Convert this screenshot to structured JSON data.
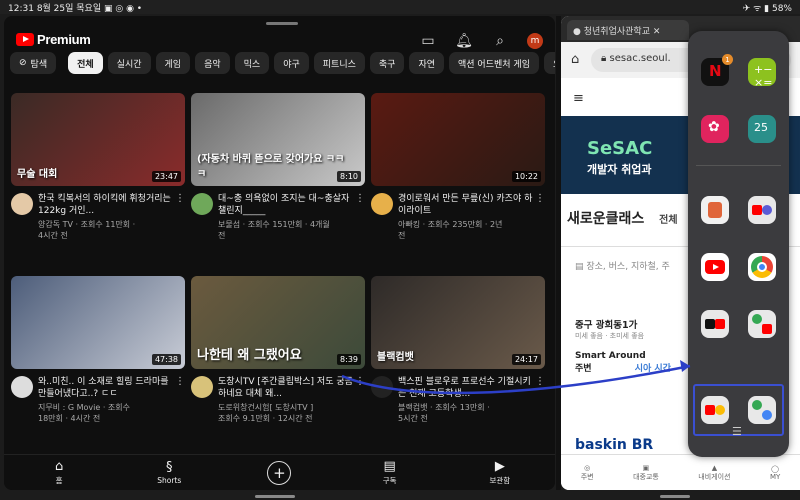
{
  "status": {
    "time": "12:31",
    "date": "8월 25일 목요일",
    "battery": "58%"
  },
  "youtube": {
    "logo": "Premium",
    "avatar_letter": "m",
    "chips": [
      "탐색",
      "전체",
      "실시간",
      "게임",
      "음악",
      "믹스",
      "야구",
      "피트니스",
      "축구",
      "자연",
      "액션 어드벤처 게임",
      "요리"
    ],
    "videos": [
      {
        "title": "한국 킥복서의 하이킥에 휘청거리는 122kg 거인...",
        "channel": "양감독 TV · 조회수 11만회 ·",
        "age": "4시간 전",
        "duration": "23:47",
        "thumb_text": "무술 대회",
        "c1": "#3a2a25",
        "c2": "#8a2b2b",
        "avc": "#e4c9a7"
      },
      {
        "title": "대~충 의욕없이 조지는 대~충살자 챌린지_____",
        "channel": "보물섬 · 조회수 151만회 · 4개월",
        "age": "전",
        "duration": "8:10",
        "thumb_text": "(자동차 바퀴 뜯으로 갖어가요 ㅋㅋㅋ",
        "c1": "#6a6a6a",
        "c2": "#c9c9c9",
        "avc": "#6fa85a"
      },
      {
        "title": "경이로워서 만든 무릎(신) 카즈야 하이라이트",
        "channel": "아빠킹 · 조회수 235만회 · 2년",
        "age": "전",
        "duration": "10:22",
        "thumb_text": "",
        "c1": "#5a1a12",
        "c2": "#2a1a14",
        "avc": "#e7b04a"
      },
      {
        "title": "와..미친.. 이 소재로 힐링 드라마를 만들어냈다고..? ㄷㄷ",
        "channel": "지무비 : G Movie · 조회수",
        "age": "18만회 · 4시간 전",
        "duration": "47:38",
        "thumb_text": "",
        "c1": "#4d5d7a",
        "c2": "#c8ccd6",
        "avc": "#dddddd"
      },
      {
        "title": "도창시TV [주간클립박스] 저도 궁금하네요 대체 왜...",
        "channel": "도로위창건시험[ 도창시TV ]",
        "age": "조회수 9.1만회 · 12시간 전",
        "duration": "8:39",
        "thumb_text": "나한테 왜 그랬어요",
        "c1": "#6b5a3e",
        "c2": "#3c4a3a",
        "avc": "#d8c27a"
      },
      {
        "title": "백스핀 블로우로 프로선수 기절시키는 천재 고등학생...",
        "channel": "블랙컴뱃 · 조회수 13만회 ·",
        "age": "5시간 전",
        "duration": "24:17",
        "thumb_text": "블랙컴뱃",
        "c1": "#2e2a28",
        "c2": "#6a5a4a",
        "avc": "#222222"
      }
    ],
    "nav": [
      "홈",
      "Shorts",
      "",
      "구독",
      "보관함"
    ]
  },
  "browser": {
    "tab": "청년취업사관학교",
    "url": "sesac.seoul.",
    "banner_a": "SeSAC",
    "banner_b": "개발자 취업과",
    "section": "새로운클래스",
    "section_more": "전체",
    "map_search": "장소, 버스, 지하철, 주",
    "map_addr": "중구 광희동1가",
    "map_dust": "미세 좋음 · 초미세 좋음",
    "map_smart": "Smart Around",
    "map_smart2": "주변",
    "map_hint": "시아 시간",
    "brand": "baskin BR",
    "map_nav": [
      "주변",
      "대중교통",
      "내비게이션",
      "MY"
    ]
  },
  "panel": {
    "badge": "1"
  }
}
